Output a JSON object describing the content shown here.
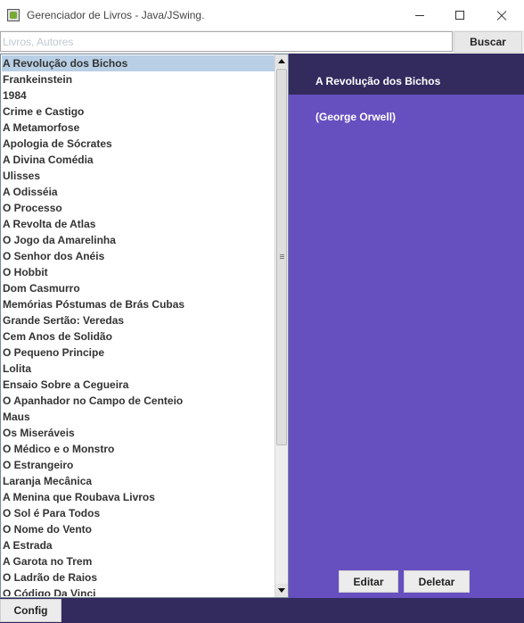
{
  "window": {
    "title": "Gerenciador de Livros - Java/JSwing."
  },
  "search": {
    "placeholder": "Livros, Autores",
    "value": "",
    "button_label": "Buscar"
  },
  "book_list": {
    "selected_index": 0,
    "items": [
      "A Revolução dos Bichos",
      "Frankeinstein",
      "1984",
      "Crime e Castigo",
      "A Metamorfose",
      "Apologia de Sócrates",
      "A Divina Comédia",
      "Ulisses",
      "A Odisséia",
      "O Processo",
      "A Revolta de Atlas",
      "O Jogo da Amarelinha",
      "O Senhor dos Anéis",
      "O Hobbit",
      "Dom Casmurro",
      "Memórias Póstumas de Brás Cubas",
      "Grande Sertão: Veredas",
      "Cem Anos de Solidão",
      "O Pequeno Principe",
      "Lolita",
      "Ensaio Sobre a Cegueira",
      "O Apanhador no Campo de Centeio",
      "Maus",
      "Os Miseráveis",
      "O Médico e o Monstro",
      "O Estrangeiro",
      "Laranja Mecânica",
      "A Menina que Roubava Livros",
      "O Sol é Para Todos",
      "O Nome do Vento",
      "A Estrada",
      "A Garota no Trem",
      "O Ladrão de Raios",
      "O Código Da Vinci"
    ]
  },
  "detail": {
    "title": "A Revolução dos Bichos",
    "author": "(George Orwell)",
    "edit_label": "Editar",
    "delete_label": "Deletar"
  },
  "footer": {
    "config_label": "Config"
  },
  "colors": {
    "panel_purple": "#6650c0",
    "header_dark_purple": "#332a5e",
    "selection_blue": "#b8cfe5"
  },
  "icons": {
    "app": "java-cup-icon",
    "minimize": "minimize-icon",
    "maximize": "maximize-icon",
    "close": "close-icon",
    "scroll_up": "arrow-up-icon",
    "scroll_down": "arrow-down-icon",
    "scroll_grip": "grip-icon"
  }
}
